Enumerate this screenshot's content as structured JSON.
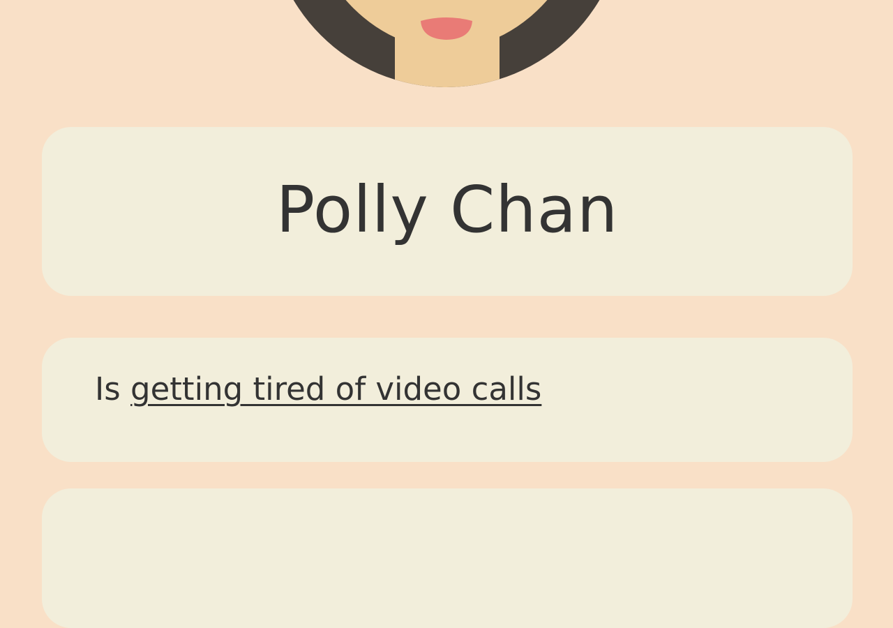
{
  "profile": {
    "name": "Polly Chan",
    "status_prefix": "Is ",
    "status_link": "getting tired of video calls"
  },
  "colors": {
    "background": "#f9e0c7",
    "card": "#f2eedb",
    "text": "#333333",
    "hair": "#46403a",
    "skin": "#eecc99",
    "mouth": "#e97b76"
  },
  "icons": {
    "avatar": "cartoon-face-avatar"
  }
}
